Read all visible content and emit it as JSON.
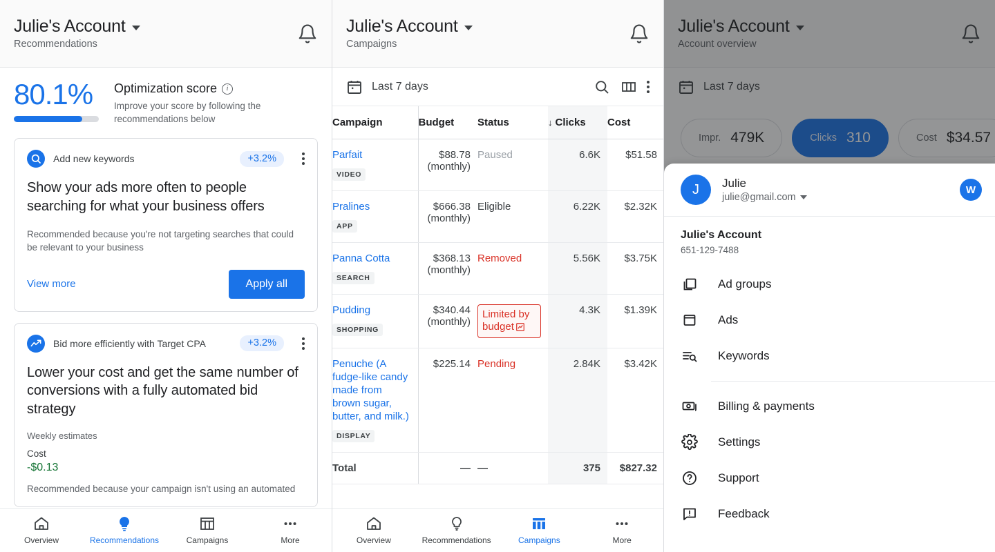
{
  "panel1": {
    "appbar": {
      "title": "Julie's Account",
      "subtitle": "Recommendations",
      "bell_icon": "notification-bell-icon",
      "caret_icon": "chevron-down-icon"
    },
    "score": {
      "percent": "80.1%",
      "progress": 80.1,
      "title": "Optimization score",
      "info_icon": "info-icon",
      "description": "Improve your score by following the recommendations below"
    },
    "cards": [
      {
        "icon": "search-icon",
        "type": "Add new keywords",
        "impact": "+3.2%",
        "menu_icon": "more-vert-icon",
        "title": "Show your ads more often to people searching for what your business offers",
        "reason": "Recommended because you're not targeting searches that could be relevant to your business",
        "view_more": "View more",
        "apply_all": "Apply all"
      },
      {
        "icon": "trending-up-icon",
        "type": "Bid more efficiently with Target CPA",
        "impact": "+3.2%",
        "menu_icon": "more-vert-icon",
        "title": "Lower your cost and get the same number of conversions with a fully automated bid strategy",
        "estimates_label": "Weekly estimates",
        "cost_label": "Cost",
        "cost_value": "-$0.13",
        "clipped_text": "Recommended because your campaign isn't using an automated"
      }
    ],
    "nav": [
      {
        "label": "Overview",
        "icon": "home-icon",
        "active": false
      },
      {
        "label": "Recommendations",
        "icon": "lightbulb-icon",
        "active": true
      },
      {
        "label": "Campaigns",
        "icon": "table-icon",
        "active": false
      },
      {
        "label": "More",
        "icon": "more-horiz-icon",
        "active": false
      }
    ]
  },
  "panel2": {
    "appbar": {
      "title": "Julie's Account",
      "subtitle": "Campaigns",
      "bell_icon": "notification-bell-icon",
      "caret_icon": "chevron-down-icon"
    },
    "toolbar": {
      "calendar_icon": "calendar-icon",
      "date_range": "Last 7 days",
      "search_icon": "search-icon",
      "columns_icon": "columns-icon",
      "more_icon": "more-vert-icon"
    },
    "table": {
      "headers": [
        "Campaign",
        "Budget",
        "Status",
        "Clicks",
        "Cost"
      ],
      "sort_column": "Clicks",
      "sort_arrow": "↓",
      "rows": [
        {
          "name": "Parfait",
          "chip": "VIDEO",
          "budget": "$88.78",
          "budget_sub": "(monthly)",
          "status": "Paused",
          "status_kind": "paused",
          "clicks": "6.6K",
          "cost": "$51.58"
        },
        {
          "name": "Pralines",
          "chip": "APP",
          "budget": "$666.38",
          "budget_sub": "(monthly)",
          "status": "Eligible",
          "status_kind": "eligible",
          "clicks": "6.22K",
          "cost": "$2.32K"
        },
        {
          "name": "Panna Cotta",
          "chip": "SEARCH",
          "budget": "$368.13",
          "budget_sub": "(monthly)",
          "status": "Removed",
          "status_kind": "removed",
          "clicks": "5.56K",
          "cost": "$3.75K"
        },
        {
          "name": "Pudding",
          "chip": "SHOPPING",
          "budget": "$340.44",
          "budget_sub": "(monthly)",
          "status": "Limited by budget",
          "status_kind": "limited",
          "clicks": "4.3K",
          "cost": "$1.39K"
        },
        {
          "name": "Penuche (A fudge-like candy made from brown sugar, butter, and milk.)",
          "chip": "DISPLAY",
          "budget": "$225.14",
          "budget_sub": "",
          "status": "Pending",
          "status_kind": "pending",
          "clicks": "2.84K",
          "cost": "$3.42K"
        }
      ],
      "total": {
        "label": "Total",
        "budget": "—",
        "status": "—",
        "clicks": "375",
        "cost": "$827.32"
      }
    },
    "nav": [
      {
        "label": "Overview",
        "icon": "home-icon",
        "active": false
      },
      {
        "label": "Recommendations",
        "icon": "lightbulb-icon",
        "active": false
      },
      {
        "label": "Campaigns",
        "icon": "table-icon",
        "active": true
      },
      {
        "label": "More",
        "icon": "more-horiz-icon",
        "active": false
      }
    ]
  },
  "panel3": {
    "appbar": {
      "title": "Julie's Account",
      "subtitle": "Account overview",
      "bell_icon": "notification-bell-icon",
      "caret_icon": "chevron-down-icon"
    },
    "toolbar": {
      "calendar_icon": "calendar-icon",
      "date_range": "Last 7 days"
    },
    "metric_chips": [
      {
        "label": "Impr.",
        "value": "479K",
        "selected": false
      },
      {
        "label": "Clicks",
        "value": "310",
        "selected": true
      },
      {
        "label": "Cost",
        "value": "$34.57",
        "selected": false
      }
    ],
    "drawer": {
      "avatar_initial": "J",
      "user_name": "Julie",
      "user_email": "julie@gmail.com",
      "email_caret_icon": "chevron-down-icon",
      "secondary_avatar_initial": "W",
      "account_name": "Julie's Account",
      "account_id": "651-129-7488",
      "menu_group_1": [
        {
          "label": "Ad groups",
          "icon": "ad-groups-icon"
        },
        {
          "label": "Ads",
          "icon": "ads-icon"
        },
        {
          "label": "Keywords",
          "icon": "keywords-icon"
        }
      ],
      "menu_group_2": [
        {
          "label": "Billing & payments",
          "icon": "billing-icon"
        },
        {
          "label": "Settings",
          "icon": "gear-icon"
        },
        {
          "label": "Support",
          "icon": "help-icon"
        },
        {
          "label": "Feedback",
          "icon": "feedback-icon"
        }
      ]
    }
  },
  "colors": {
    "accent_blue": "#1a73e8",
    "chip_selected_blue": "#174ea6",
    "error_red": "#d93025",
    "success_green": "#137333",
    "muted_gray": "#5f6368",
    "disabled_gray": "#9aa0a6"
  }
}
